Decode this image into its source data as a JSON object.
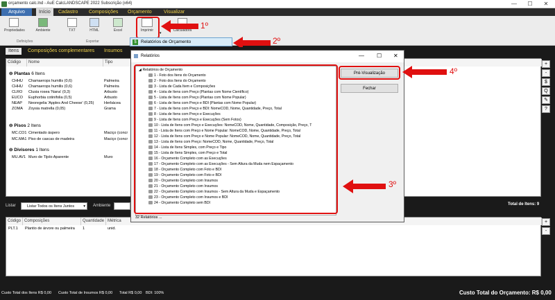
{
  "window": {
    "title": "orçamento calc.lnd - AuE CalcLANDSCAPE 2022 Subscrição (x64)",
    "minimize": "—",
    "maximize": "☐",
    "close": "✕"
  },
  "menubar": [
    "Arquivo",
    "Início",
    "Cadastro",
    "Composições",
    "Orçamento",
    "Visualizar"
  ],
  "ribbon": {
    "buttons": [
      "Propriedades",
      "Ambiente",
      "TXT",
      "HTML",
      "Excel",
      "Imprimir",
      "Calculadora"
    ],
    "groups": [
      "Definições",
      "Exportar"
    ]
  },
  "popup": {
    "label": "Relatórios de Orçamento",
    "icon": "$"
  },
  "tabs": [
    "Itens",
    "Composições complementares",
    "Insumos"
  ],
  "grid": {
    "headers": [
      "Código",
      "Nome",
      "Tipo"
    ],
    "groups": [
      {
        "label": "Plantas",
        "count": "6 Itens",
        "rows": [
          [
            "CHHU",
            "Chamaerops humilis (0,6)",
            "Palmeira"
          ],
          [
            "CHHU",
            "Chamaerops humilis (0,6)",
            "Palmeira"
          ],
          [
            "CLRO",
            "Clusia rosea 'Nana' (0,3)",
            "Arbusto"
          ],
          [
            "EUCO",
            "Euphorbia cotinifolia (0,5)",
            "Arbusto"
          ],
          [
            "NEAP",
            "Neoregelia 'Apples And Cheese' (0,25)",
            "Herbácea"
          ],
          [
            "ZOMA",
            "Zoysia matrella (0,05)",
            "Grama"
          ]
        ]
      },
      {
        "label": "Pisos",
        "count": "2 Itens",
        "rows": [
          [
            "MC.CO1",
            "Cimentado áspero",
            "Maciço (concr"
          ],
          [
            "MC.MA1",
            "Piso de cascas de madeira",
            "Maciço (concr"
          ]
        ]
      },
      {
        "label": "Divisores",
        "count": "1 Itens",
        "rows": [
          [
            "MU.AV1",
            "Muro de Tijolo Aparente",
            "Muro"
          ]
        ]
      }
    ],
    "total": "Total de Itens: 9",
    "side_buttons": [
      "+",
      "-",
      "$",
      "Q",
      "✎",
      "?"
    ]
  },
  "filter": {
    "label": "Listar",
    "value": "Listar Todos os Itens Juntos",
    "ambiente": "Ambiente"
  },
  "grid2": {
    "headers": [
      "Código",
      "Composições",
      "Quantidade",
      "Métrica"
    ],
    "rows": [
      [
        "PLT.1",
        "Plantio de árvore ou palmeira",
        "1",
        "unid."
      ]
    ]
  },
  "status": {
    "items": "Custo Total dos Itens R$ 0,00",
    "insumos": "Custo Total de Insumos R$ 0,00",
    "total": "Total R$ 0,00",
    "bdi": "BDI: 100%",
    "grand": "Custo Total do Orçamento: R$ 0,00"
  },
  "dialog": {
    "title": "Relatórios",
    "tree_root": "Relatórios de Orçamento",
    "items": [
      "1 - Foto dos Itens do Orçamento",
      "2 - Foto dos Itens do Orçamento",
      "3 - Lista de Cada Item e Composições",
      "4 - Lista de Itens com Preço (Plantas com Nome Científico)",
      "5 - Lista de Itens com Preço (Plantas com Nome Popular)",
      "6 - Lista de Itens com Preço e BDI (Plantas com Nome Popular)",
      "7 - Lista de Itens com Preço e BDI: NomeCOD, Nome, Quantidade, Preço, Total",
      "8 - Lista de Itens com Preço e Execuções",
      "9 - Lista de Itens com Preço e Execuções (Sem Fotos)",
      "10 - Lista de Itens com Preço e Execuções: NomeCOD, Nome, Quantidade, Composição, Preço, T",
      "11 - Lista de Itens com Preço e Nome Popular: NomeCOD, Nome, Quantidade, Preço, Total",
      "12 - Lista de Itens com Preço e Nome Popular: NomeCOD, Nome, Quantidade, Preço, Total",
      "13 - Lista de Itens com Preço: NomeCOD, Nome, Quantidade, Preço, Total",
      "14 - Lista de Itens Simples, com Preço e Tipo",
      "15 - Lista de Itens Simples, com Preço e Total",
      "16 - Orçamento Completo com as Execuções",
      "17 - Orçamento Completo com as Execuções - Sem Altura da Muda nem Espaçamento",
      "18 - Orçamento Completo com Foto e BDI",
      "19 - Orçamento Completo com Foto e BDI",
      "20 - Orçamento Completo com Insumos",
      "21 - Orçamento Completo com Insumos",
      "22 - Orçamento Completo com Insumos - Sem Altura da Muda e Espaçamento",
      "23 - Orçamento Completo com Insumos e BDI",
      "24 - Orçamento Completo sem BDI"
    ],
    "status": "32 Relatórios ...",
    "btn_preview": "Pré-Visualização",
    "btn_close": "Fechar"
  },
  "annotations": [
    "1º",
    "2º",
    "3º",
    "4º"
  ]
}
